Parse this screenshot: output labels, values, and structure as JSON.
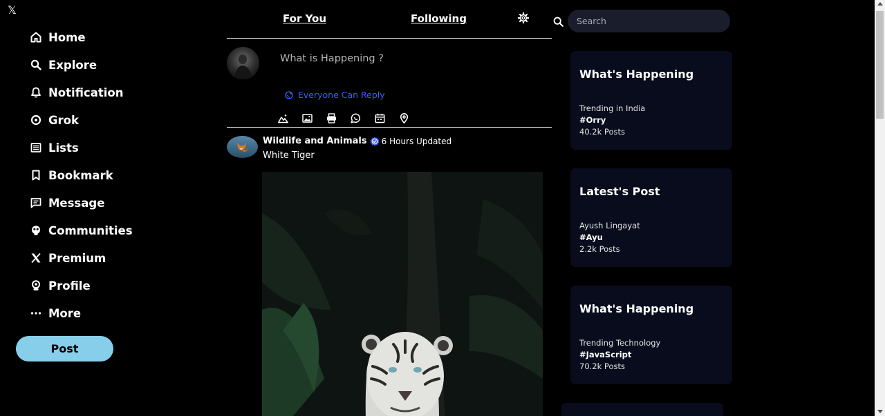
{
  "brand": {
    "logo_glyph": "𝕏"
  },
  "sidebar": {
    "items": [
      {
        "label": "Home",
        "icon": "home-icon"
      },
      {
        "label": "Explore",
        "icon": "search-icon"
      },
      {
        "label": "Notification",
        "icon": "bell-icon"
      },
      {
        "label": "Grok",
        "icon": "grok-icon"
      },
      {
        "label": "Lists",
        "icon": "list-icon"
      },
      {
        "label": "Bookmark",
        "icon": "bookmark-icon"
      },
      {
        "label": "Message",
        "icon": "message-icon"
      },
      {
        "label": "Communities",
        "icon": "communities-icon"
      },
      {
        "label": "Premium",
        "icon": "x-icon"
      },
      {
        "label": "Profile",
        "icon": "profile-icon"
      },
      {
        "label": "More",
        "icon": "more-icon"
      }
    ],
    "post_button": "Post"
  },
  "feed": {
    "tabs": [
      {
        "label": "For You"
      },
      {
        "label": "Following"
      }
    ],
    "composer": {
      "placeholder": "What is Happening ?",
      "reply_setting": "Everyone Can Reply",
      "tools": [
        "media-icon",
        "image-icon",
        "gif-icon",
        "poll-icon",
        "schedule-icon",
        "location-icon"
      ]
    },
    "post": {
      "author": "Wildlife and Animals",
      "time": "6 Hours Updated",
      "text": "White Tiger"
    }
  },
  "right": {
    "search_placeholder": "Search",
    "cards": [
      {
        "title": "What's Happening",
        "subtitle": "Trending in India",
        "tag": "#Orry",
        "count": "40.2k Posts"
      },
      {
        "title": "Latest's Post",
        "subtitle": "Ayush Lingayat",
        "tag": "#Ayu",
        "count": "2.2k Posts"
      },
      {
        "title": "What's Happening",
        "subtitle": "Trending Technology",
        "tag": "#JavaScript",
        "count": "70.2k Posts"
      }
    ]
  },
  "colors": {
    "background": "#000000",
    "post_button": "#87ceeb",
    "reply_link": "#3b5bff",
    "card_bg": "#080c1c",
    "search_bg": "#1a1d2b"
  }
}
